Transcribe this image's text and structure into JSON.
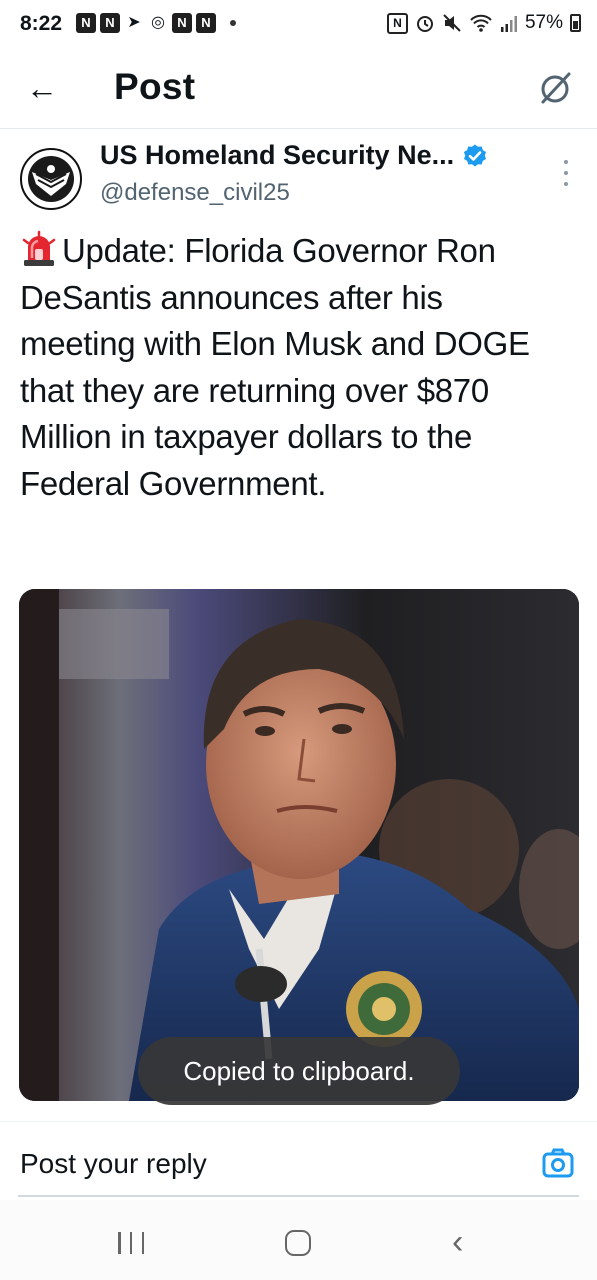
{
  "status_bar": {
    "time": "8:22",
    "notification_icons": [
      "N",
      "N",
      "send-icon",
      "chrome-icon",
      "N",
      "N"
    ],
    "battery": "57%"
  },
  "header": {
    "back_icon": "←",
    "title": "Post",
    "grok_icon": "grok-icon"
  },
  "post": {
    "author": {
      "name": "US Homeland Security Ne...",
      "handle": "@defense_civil25",
      "verified": true,
      "verified_color": "#1d9bf0"
    },
    "text": "Update: Florida Governor Ron DeSantis announces after his meeting with Elon Musk and DOGE that they are returning over $870 Million in taxpayer dollars to the Federal Government.",
    "emoji": "rotating-light-icon",
    "media": {
      "type": "photo"
    }
  },
  "toast": {
    "text": "Copied to clipboard."
  },
  "reply": {
    "placeholder": "Post your reply",
    "accent_color": "#1d9bf0"
  },
  "nav_bar": {
    "items": [
      "recent-apps-icon",
      "home-icon",
      "back-icon"
    ]
  }
}
